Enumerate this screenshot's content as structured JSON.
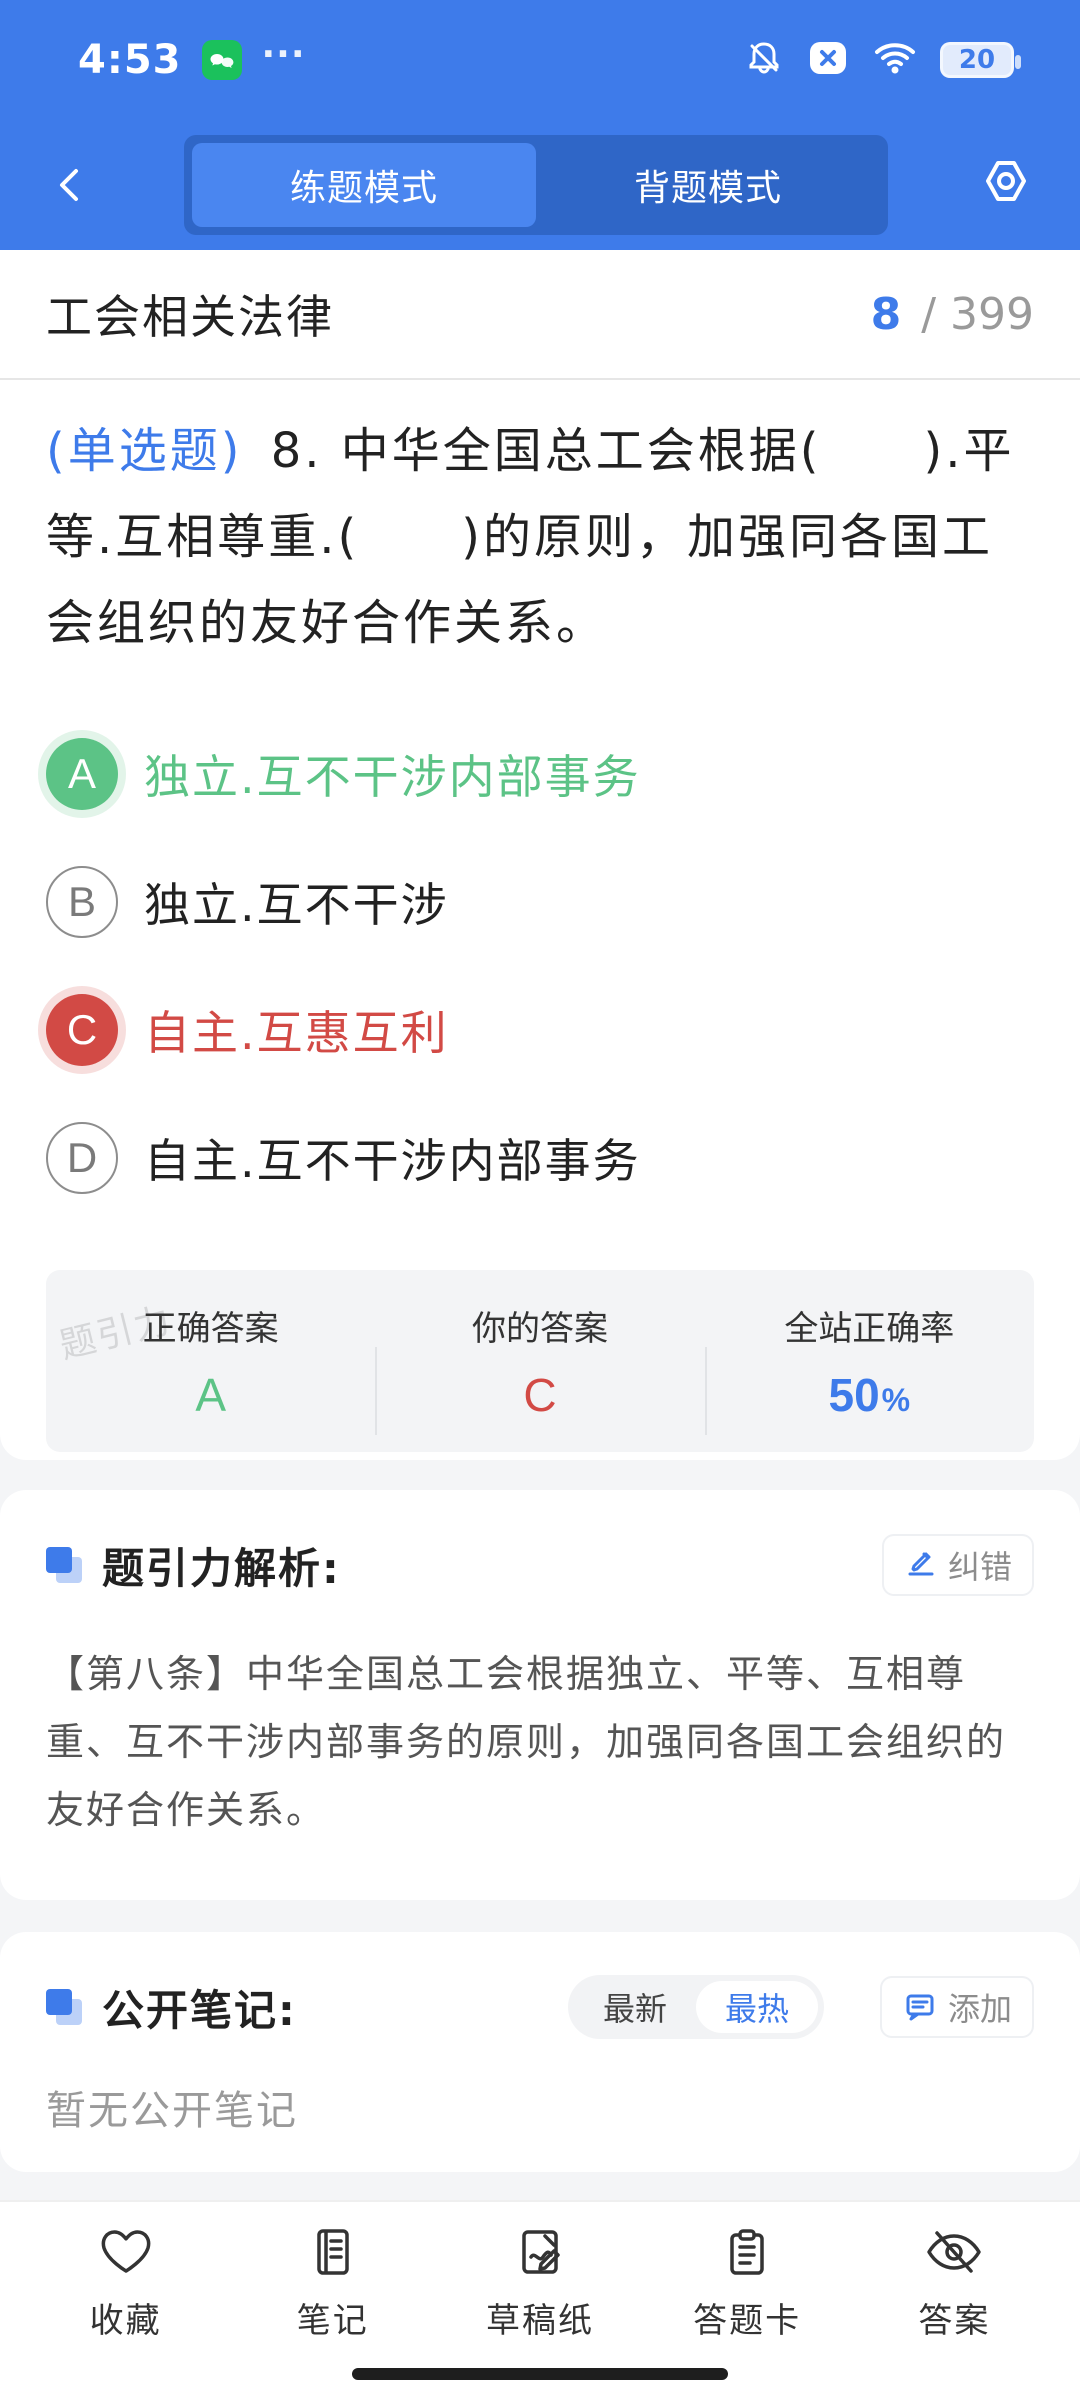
{
  "status_bar": {
    "time": "4:53",
    "more": "···",
    "battery": "20",
    "icons": [
      "wechat-icon",
      "bell-muted-icon",
      "close-badge-icon",
      "wifi-icon",
      "battery-icon"
    ]
  },
  "header": {
    "mode_tabs": [
      {
        "label": "练题模式",
        "active": true
      },
      {
        "label": "背题模式",
        "active": false
      }
    ],
    "icons": {
      "back": "chevron-left-icon",
      "settings": "settings-hex-icon"
    }
  },
  "question": {
    "section_title": "工会相关法律",
    "current": "8",
    "total": "/ 399",
    "type_label": "(单选题)",
    "number": "8.",
    "text": "中华全国总工会根据(　　).平等.互相尊重.(　　)的原则，加强同各国工会组织的友好合作关系。",
    "options": [
      {
        "key": "A",
        "text": "独立.互不干涉内部事务",
        "state": "correct"
      },
      {
        "key": "B",
        "text": "独立.互不干涉",
        "state": "normal"
      },
      {
        "key": "C",
        "text": "自主.互惠互利",
        "state": "wrong"
      },
      {
        "key": "D",
        "text": "自主.互不干涉内部事务",
        "state": "normal"
      }
    ]
  },
  "answer_summary": {
    "watermark": "题引力",
    "correct_label": "正确答案",
    "correct_value": "A",
    "your_label": "你的答案",
    "your_value": "C",
    "rate_label": "全站正确率",
    "rate_value": "50",
    "rate_unit": "%"
  },
  "analysis": {
    "title": "题引力解析:",
    "report_label": "纠错",
    "text": "【第八条】中华全国总工会根据独立、平等、互相尊重、互不干涉内部事务的原则，加强同各国工会组织的友好合作关系。"
  },
  "notes": {
    "title": "公开笔记:",
    "tabs": [
      {
        "label": "最新",
        "active": false
      },
      {
        "label": "最热",
        "active": true
      }
    ],
    "add_label": "添加",
    "empty_text": "暂无公开笔记"
  },
  "bottom_nav": [
    {
      "label": "收藏",
      "icon": "heart-icon"
    },
    {
      "label": "笔记",
      "icon": "notebook-icon"
    },
    {
      "label": "草稿纸",
      "icon": "draft-icon"
    },
    {
      "label": "答题卡",
      "icon": "clipboard-icon"
    },
    {
      "label": "答案",
      "icon": "eye-off-icon"
    }
  ],
  "colors": {
    "primary": "#3E7BEA",
    "correct": "#5CC386",
    "wrong": "#D24A45"
  }
}
